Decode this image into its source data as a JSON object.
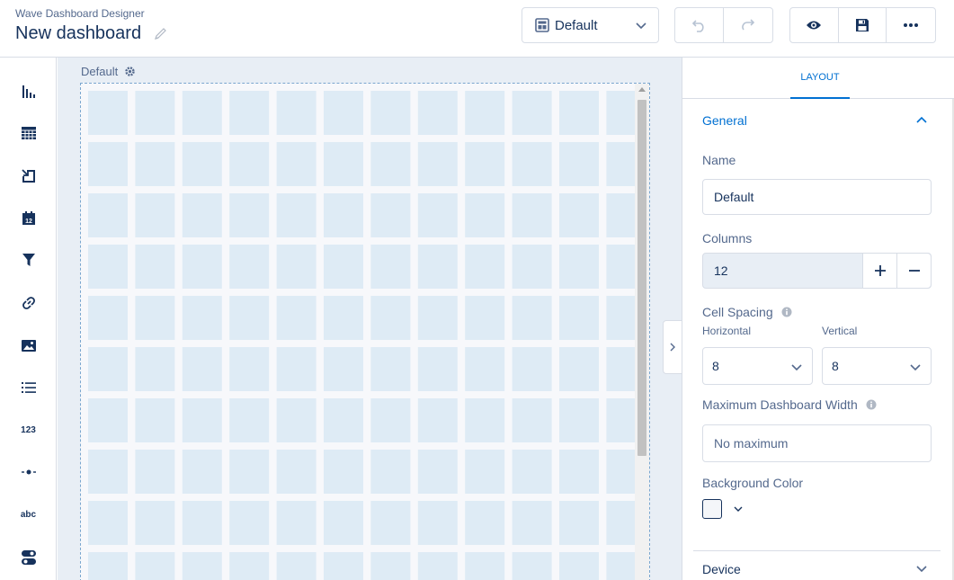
{
  "header": {
    "app_title": "Wave Dashboard Designer",
    "dashboard_title": "New dashboard",
    "layout_select": "Default"
  },
  "toolbar": {
    "number_label": "123",
    "text_label": "abc"
  },
  "canvas": {
    "layout_label": "Default"
  },
  "panel": {
    "tab_layout": "LAYOUT",
    "general": {
      "title": "General",
      "name_label": "Name",
      "name_value": "Default",
      "columns_label": "Columns",
      "columns_value": "12",
      "cell_spacing_label": "Cell Spacing",
      "horizontal_label": "Horizontal",
      "vertical_label": "Vertical",
      "horizontal_value": "8",
      "vertical_value": "8",
      "max_width_label": "Maximum Dashboard Width",
      "max_width_placeholder": "No maximum",
      "bg_color_label": "Background Color"
    },
    "device_title": "Device"
  },
  "colors": {
    "accent": "#0070d2",
    "text": "#16325c",
    "canvas_bg": "#e8eef5",
    "cell": "#deebf5"
  }
}
